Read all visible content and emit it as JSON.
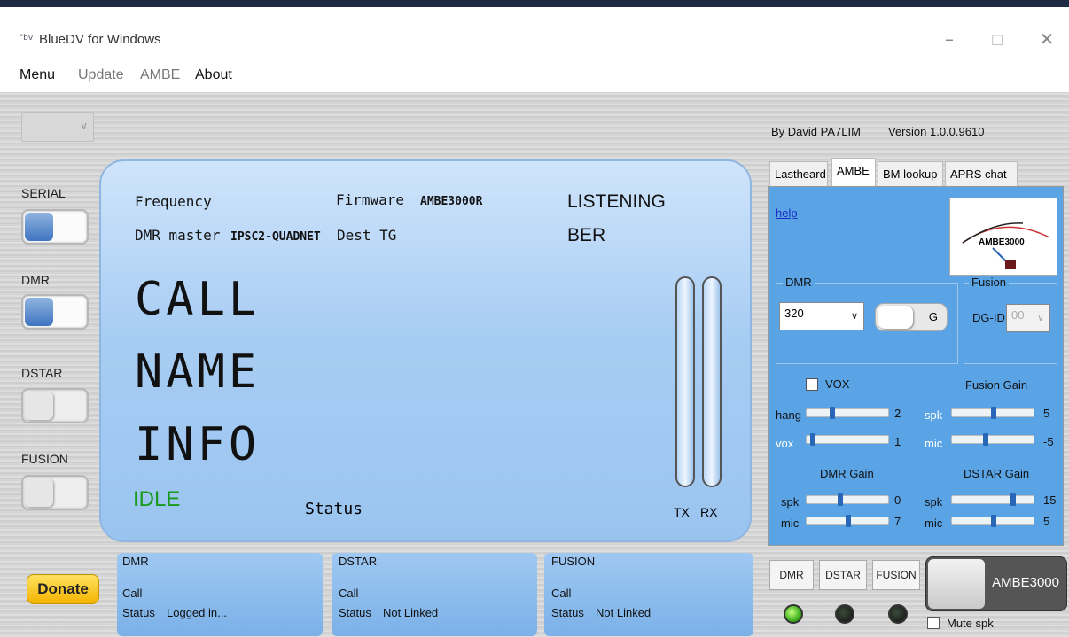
{
  "window": {
    "title": "BlueDV for Windows",
    "icon_text": "\"bv"
  },
  "menubar": {
    "items": [
      "Menu",
      "Update",
      "AMBE",
      "About"
    ]
  },
  "sidebar": {
    "serial": "SERIAL",
    "dmr": "DMR",
    "dstar": "DSTAR",
    "fusion": "FUSION"
  },
  "display": {
    "frequency_label": "Frequency",
    "firmware_label": "Firmware",
    "firmware_value": "AMBE3000R",
    "listening": "LISTENING",
    "dmr_master_label": "DMR master",
    "dmr_master_value": "IPSC2-QUADNET",
    "dest_tg_label": "Dest TG",
    "ber": "BER",
    "call": "CALL",
    "name": "NAME",
    "info": "INFO",
    "idle": "IDLE",
    "status": "Status",
    "tx": "TX",
    "rx": "RX"
  },
  "header": {
    "author": "By David PA7LIM",
    "version": "Version 1.0.0.9610"
  },
  "tabs": [
    "Lastheard",
    "AMBE",
    "BM lookup",
    "APRS chat"
  ],
  "ambe_panel": {
    "help": "help",
    "meter_label": "AMBE3000",
    "dmr_group": "DMR",
    "dmr_select": "320",
    "g_label": "G",
    "fusion_group": "Fusion",
    "dgid_label": "DG-ID",
    "dgid_value": "00",
    "vox_label": "VOX",
    "fusion_gain": "Fusion Gain",
    "hang_label": "hang",
    "hang_value": "2",
    "vox_label2": "vox",
    "vox_value": "1",
    "fusion_spk_label": "spk",
    "fusion_spk_value": "5",
    "fusion_mic_label": "mic",
    "fusion_mic_value": "-5",
    "dmr_gain": "DMR Gain",
    "dstar_gain": "DSTAR Gain",
    "dmr_spk_label": "spk",
    "dmr_spk_value": "0",
    "dmr_mic_label": "mic",
    "dmr_mic_value": "7",
    "dstar_spk_label": "spk",
    "dstar_spk_value": "15",
    "dstar_mic_label": "mic",
    "dstar_mic_value": "5",
    "slider_levels": {
      "hang": 0.3,
      "vox": 0.05,
      "fusion_spk": 0.5,
      "fusion_mic": 0.4,
      "dmr_spk": 0.4,
      "dmr_mic": 0.5,
      "dstar_spk": 0.75,
      "dstar_mic": 0.5
    }
  },
  "bottom": {
    "donate": "Donate",
    "dmr": {
      "title": "DMR",
      "call_label": "Call",
      "status_label": "Status",
      "status_value": "Logged in..."
    },
    "dstar": {
      "title": "DSTAR",
      "call_label": "Call",
      "status_label": "Status",
      "status_value": "Not Linked"
    },
    "fusion": {
      "title": "FUSION",
      "call_label": "Call",
      "status_label": "Status",
      "status_value": "Not Linked"
    },
    "mode_buttons": [
      "DMR",
      "DSTAR",
      "FUSION"
    ],
    "ambe_button": "AMBE3000",
    "mute": "Mute spk"
  }
}
